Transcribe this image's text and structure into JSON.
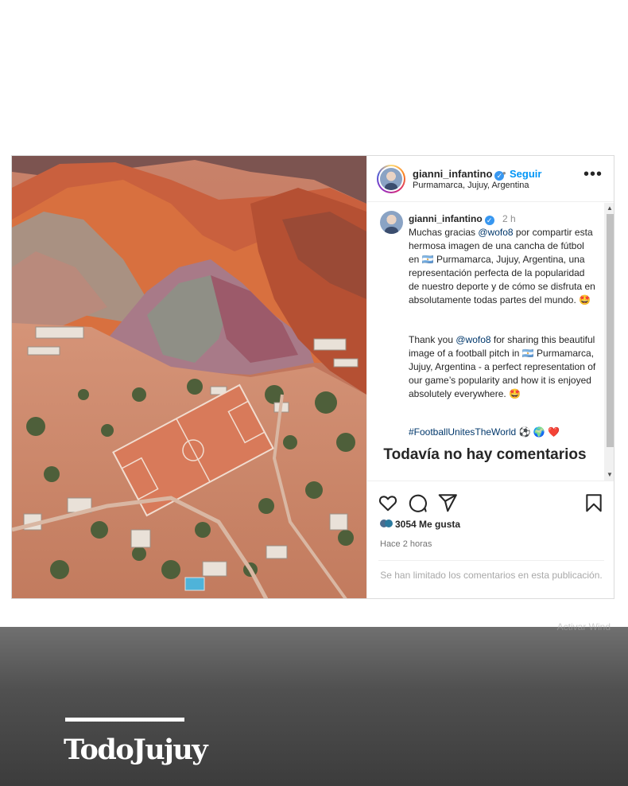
{
  "post": {
    "username": "gianni_infantino",
    "follow_label": "Seguir",
    "separator": "•",
    "location": "Purmamarca, Jujuy, Argentina",
    "more_label": "•••",
    "caption": {
      "time": "2 h",
      "es_before": " Muchas gracias ",
      "es_mention": "@wofo8",
      "es_after": " por compartir esta hermosa imagen de una cancha de fútbol en 🇦🇷 Purmamarca, Jujuy, Argentina, una representación perfecta de la popularidad de nuestro deporte y de cómo se disfruta en absolutamente todas partes del mundo. 🤩",
      "en_before": "Thank you ",
      "en_mention": "@wofo8",
      "en_after": " for sharing this beautiful image of a football pitch in 🇦🇷 Purmamarca, Jujuy, Argentina - a perfect representation of our game’s popularity and how it is enjoyed absolutely everywhere. 🤩",
      "hashtags": "#FootballUnitesTheWorld ⚽ 🌍 ❤️"
    },
    "no_comments": "Todavía no hay comentarios",
    "likes": "3054 Me gusta",
    "posted": "Hace 2 horas",
    "comments_limited": "Se han limitado los comentarios en esta publicación.",
    "scroll_up": "▲",
    "scroll_down": "▼"
  },
  "banner": {
    "brand": "TodoJujuy",
    "ghost_text": "Activar Wind"
  },
  "colors": {
    "link_blue": "#0095f6",
    "mention_blue": "#00376b",
    "verified_blue": "#3897f0",
    "banner_gray": "#505050"
  },
  "icons": [
    "verified-badge-icon",
    "more-options-icon",
    "heart-icon",
    "comment-icon",
    "share-icon",
    "bookmark-icon"
  ]
}
